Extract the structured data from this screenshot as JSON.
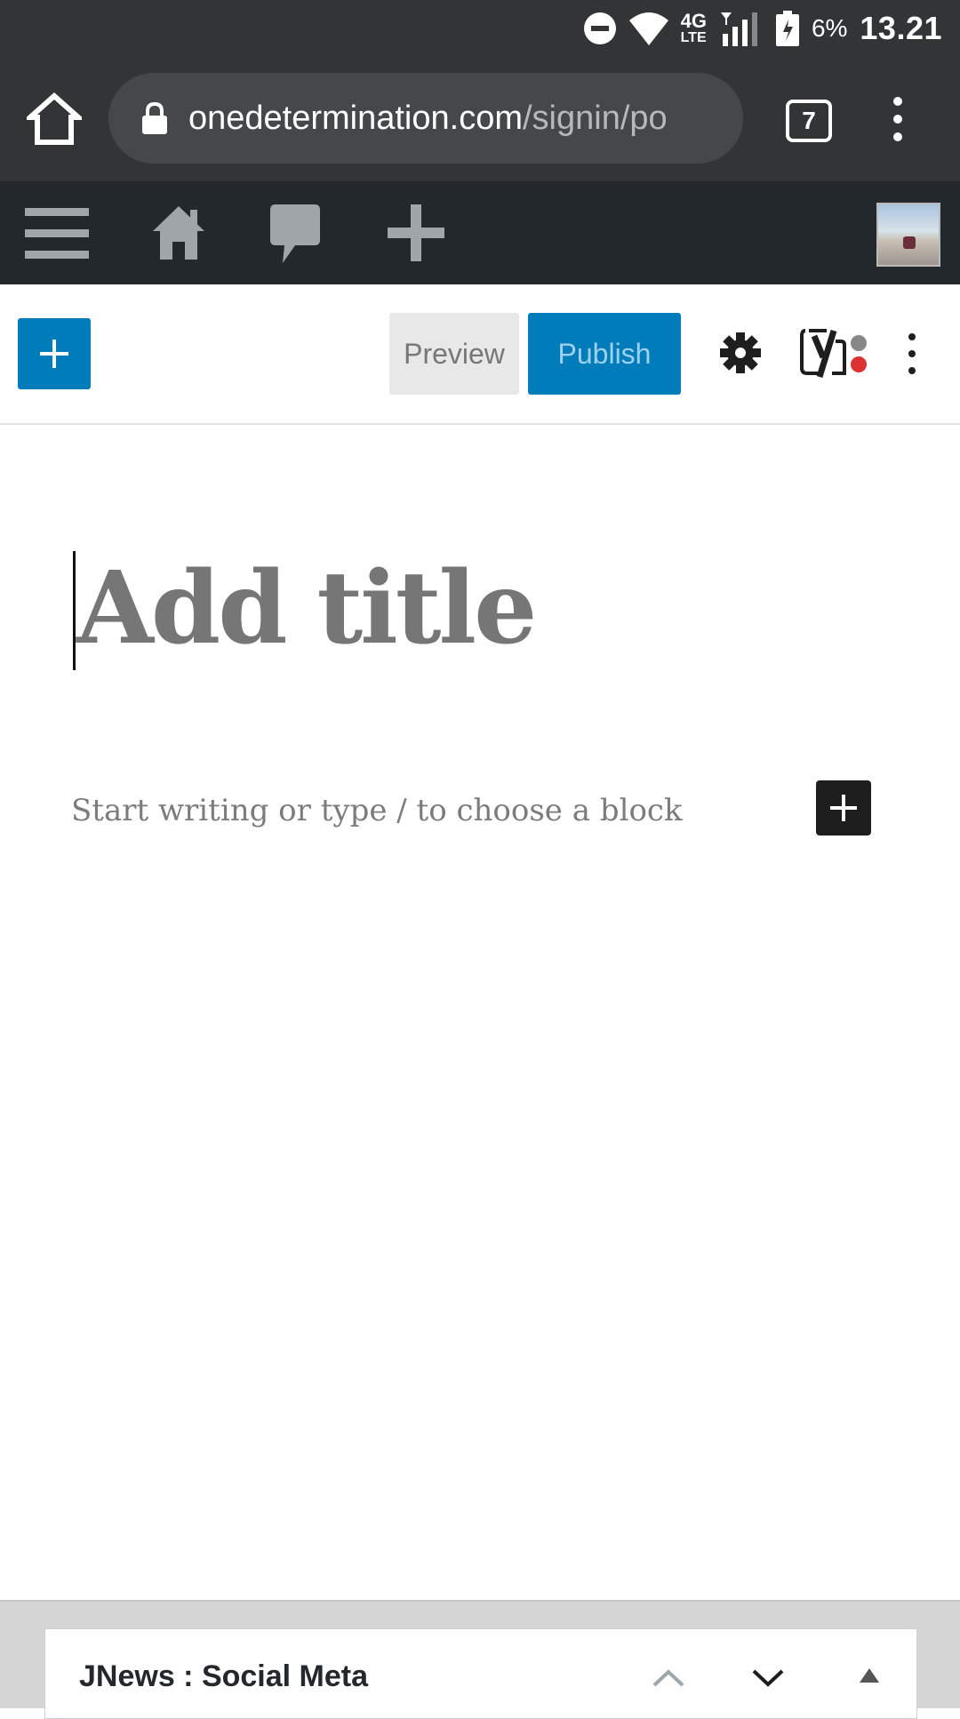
{
  "status_bar": {
    "network_top": "4G",
    "network_bottom": "LTE",
    "battery": "6%",
    "time": "13.21"
  },
  "browser": {
    "url_domain": "onedetermination.com",
    "url_path": "/signin/po",
    "tab_count": "7"
  },
  "admin_bar": {
    "icons": [
      "menu-icon",
      "home-icon",
      "comment-icon",
      "add-new-icon"
    ]
  },
  "toolbar": {
    "preview_label": "Preview",
    "publish_label": "Publish"
  },
  "editor": {
    "title_placeholder": "Add title",
    "block_placeholder": "Start writing or type / to choose a block"
  },
  "meta_box": {
    "title": "JNews : Social Meta"
  },
  "colors": {
    "wp_blue": "#007cba",
    "admin_bar": "#23282d",
    "browser_bar": "#323436",
    "yoast_red": "#dc3232"
  }
}
